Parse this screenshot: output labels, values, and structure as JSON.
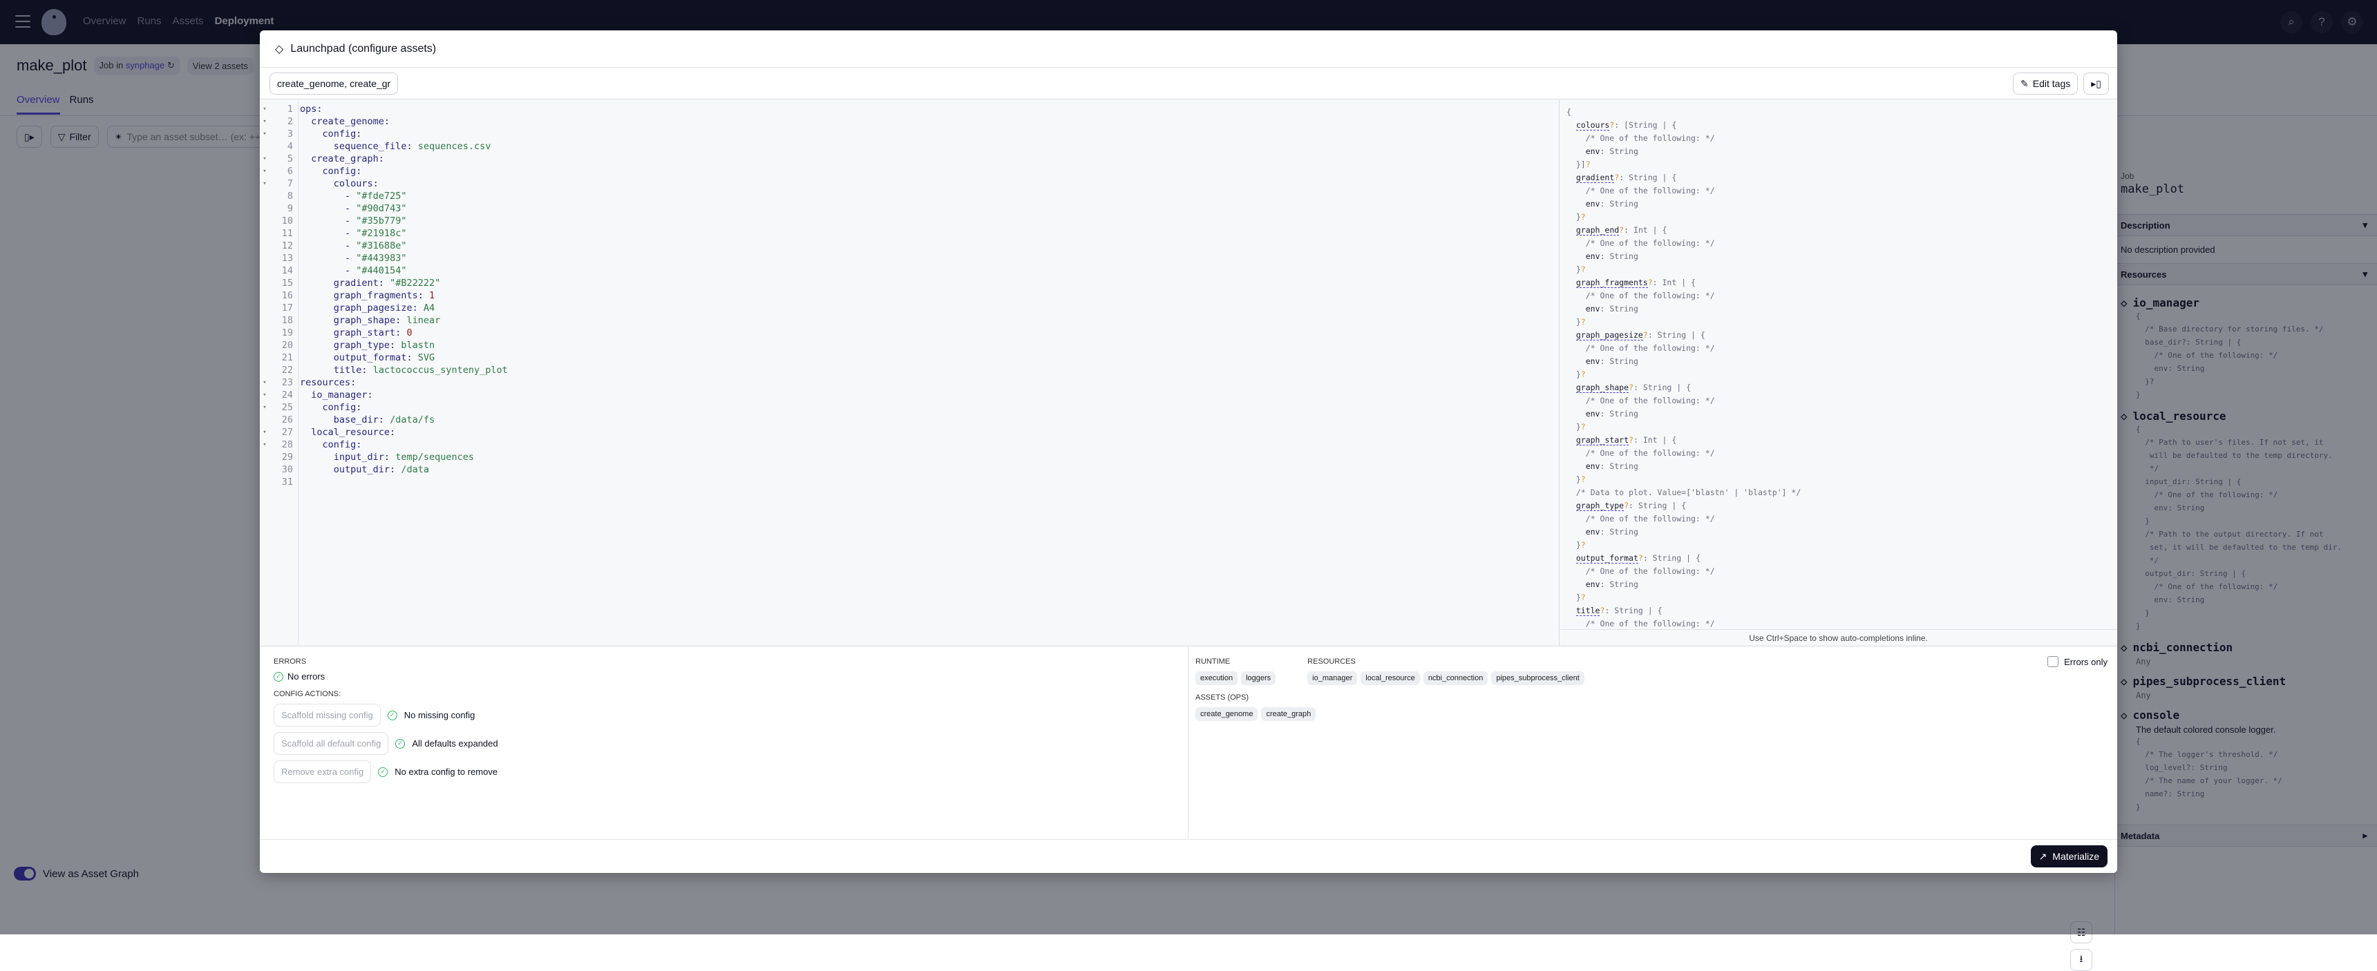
{
  "topbar": {
    "nav": [
      "Overview",
      "Runs",
      "Assets",
      "Deployment"
    ],
    "active_nav": "Deployment",
    "icons": [
      "search-icon",
      "help-icon",
      "gear-icon"
    ]
  },
  "page": {
    "title": "make_plot",
    "job_pill_prefix": "Job in",
    "job_pill_repo": "synphage",
    "assets_pill": "View 2 assets",
    "tabs": [
      "Overview",
      "Runs"
    ],
    "filter_label": "Filter",
    "asset_search_placeholder": "Type an asset subset… (ex: ++c",
    "toggle_label": "View as Asset Graph",
    "toggle_on": true
  },
  "sidebar": {
    "job_label": "Job",
    "job_name": "make_plot",
    "description_header": "Description",
    "description_text": "No description provided",
    "resources_header": "Resources",
    "metadata_header": "Metadata",
    "resources": [
      {
        "name": "io_manager",
        "schema": "{\n  /* Base directory for storing files. */\n  base_dir?: String | {\n    /* One of the following: */\n    env: String\n  }?\n}"
      },
      {
        "name": "local_resource",
        "schema": "{\n  /* Path to user's files. If not set, it\n   will be defaulted to the temp directory.\n   */\n  input_dir: String | {\n    /* One of the following: */\n    env: String\n  }\n  /* Path to the output directory. If not\n   set, it will be defaulted to the temp dir.\n   */\n  output_dir: String | {\n    /* One of the following: */\n    env: String\n  }\n}"
      },
      {
        "name": "ncbi_connection",
        "any": "Any"
      },
      {
        "name": "pipes_subprocess_client",
        "any": "Any"
      },
      {
        "name": "console",
        "desc": "The default colored console logger.",
        "schema": "{\n  /* The logger's threshold. */\n  log_level?: String\n  /* The name of your logger. */\n  name?: String\n}"
      }
    ]
  },
  "modal": {
    "title": "Launchpad (configure assets)",
    "tab_input_value": "create_genome, create_gr",
    "edit_tags_label": "Edit tags",
    "editor_lines": [
      {
        "n": 1,
        "fold": true,
        "indent": 0,
        "key": "ops",
        "val": ""
      },
      {
        "n": 2,
        "fold": true,
        "indent": 1,
        "key": "create_genome",
        "val": ""
      },
      {
        "n": 3,
        "fold": true,
        "indent": 2,
        "key": "config",
        "val": ""
      },
      {
        "n": 4,
        "fold": false,
        "indent": 3,
        "key": "sequence_file",
        "val": "sequences.csv"
      },
      {
        "n": 5,
        "fold": true,
        "indent": 1,
        "key": "create_graph",
        "val": ""
      },
      {
        "n": 6,
        "fold": true,
        "indent": 2,
        "key": "config",
        "val": ""
      },
      {
        "n": 7,
        "fold": true,
        "indent": 3,
        "key": "colours",
        "val": ""
      },
      {
        "n": 8,
        "fold": false,
        "indent": 4,
        "item": "\"#fde725\""
      },
      {
        "n": 9,
        "fold": false,
        "indent": 4,
        "item": "\"#90d743\""
      },
      {
        "n": 10,
        "fold": false,
        "indent": 4,
        "item": "\"#35b779\""
      },
      {
        "n": 11,
        "fold": false,
        "indent": 4,
        "item": "\"#21918c\""
      },
      {
        "n": 12,
        "fold": false,
        "indent": 4,
        "item": "\"#31688e\""
      },
      {
        "n": 13,
        "fold": false,
        "indent": 4,
        "item": "\"#443983\""
      },
      {
        "n": 14,
        "fold": false,
        "indent": 4,
        "item": "\"#440154\""
      },
      {
        "n": 15,
        "fold": false,
        "indent": 3,
        "key": "gradient",
        "val": "\"#B22222\""
      },
      {
        "n": 16,
        "fold": false,
        "indent": 3,
        "key": "graph_fragments",
        "num": "1"
      },
      {
        "n": 17,
        "fold": false,
        "indent": 3,
        "key": "graph_pagesize",
        "val": "A4"
      },
      {
        "n": 18,
        "fold": false,
        "indent": 3,
        "key": "graph_shape",
        "val": "linear"
      },
      {
        "n": 19,
        "fold": false,
        "indent": 3,
        "key": "graph_start",
        "num": "0"
      },
      {
        "n": 20,
        "fold": false,
        "indent": 3,
        "key": "graph_type",
        "val": "blastn"
      },
      {
        "n": 21,
        "fold": false,
        "indent": 3,
        "key": "output_format",
        "val": "SVG"
      },
      {
        "n": 22,
        "fold": false,
        "indent": 3,
        "key": "title",
        "val": "lactococcus_synteny_plot"
      },
      {
        "n": 23,
        "fold": true,
        "indent": 0,
        "key": "resources",
        "val": ""
      },
      {
        "n": 24,
        "fold": true,
        "indent": 1,
        "key": "io_manager",
        "val": ""
      },
      {
        "n": 25,
        "fold": true,
        "indent": 2,
        "key": "config",
        "val": ""
      },
      {
        "n": 26,
        "fold": false,
        "indent": 3,
        "key": "base_dir",
        "val": "/data/fs"
      },
      {
        "n": 27,
        "fold": true,
        "indent": 1,
        "key": "local_resource",
        "val": ""
      },
      {
        "n": 28,
        "fold": true,
        "indent": 2,
        "key": "config",
        "val": ""
      },
      {
        "n": 29,
        "fold": false,
        "indent": 3,
        "key": "input_dir",
        "val": "temp/sequences"
      },
      {
        "n": 30,
        "fold": false,
        "indent": 3,
        "key": "output_dir",
        "val": "/data"
      },
      {
        "n": 31,
        "fold": false,
        "indent": 0,
        "key": "",
        "val": ""
      }
    ],
    "schema_fields": [
      {
        "key": "colours",
        "type": "[String | {",
        "close": "}]?"
      },
      {
        "key": "gradient",
        "type": "String | {",
        "close": "}?"
      },
      {
        "key": "graph_end",
        "type": "Int | {",
        "close": "}?"
      },
      {
        "key": "graph_fragments",
        "type": "Int | {",
        "close": "}?"
      },
      {
        "key": "graph_pagesize",
        "type": "String | {",
        "close": "}?"
      },
      {
        "key": "graph_shape",
        "type": "String | {",
        "close": "}?"
      },
      {
        "key": "graph_start",
        "type": "Int | {",
        "close": "}?"
      },
      {
        "key": "graph_type",
        "type": "String | {",
        "close": "}?",
        "comment": "/* Data to plot. Value=['blastn' | 'blastp'] */"
      },
      {
        "key": "output_format",
        "type": "String | {",
        "close": "}?"
      },
      {
        "key": "title",
        "type": "String | {",
        "close": ""
      }
    ],
    "schema_inner_comment": "/* One of the following: */",
    "schema_inner_env": "env",
    "schema_inner_env_type": "String",
    "hint": "Use Ctrl+Space to show auto-completions inline.",
    "errors_header": "ERRORS",
    "no_errors": "No errors",
    "config_actions_header": "CONFIG ACTIONS:",
    "actions": [
      {
        "button": "Scaffold missing config",
        "status": "No missing config"
      },
      {
        "button": "Scaffold all default config",
        "status": "All defaults expanded"
      },
      {
        "button": "Remove extra config",
        "status": "No extra config to remove"
      }
    ],
    "runtime_header": "RUNTIME",
    "runtime_tags": [
      "execution",
      "loggers"
    ],
    "resources_header": "RESOURCES",
    "resources_tags": [
      "io_manager",
      "local_resource",
      "ncbi_connection",
      "pipes_subprocess_client"
    ],
    "assets_header": "ASSETS (OPS)",
    "assets_tags": [
      "create_genome",
      "create_graph"
    ],
    "errors_only_label": "Errors only",
    "errors_only_checked": false,
    "materialize_label": "Materialize"
  }
}
